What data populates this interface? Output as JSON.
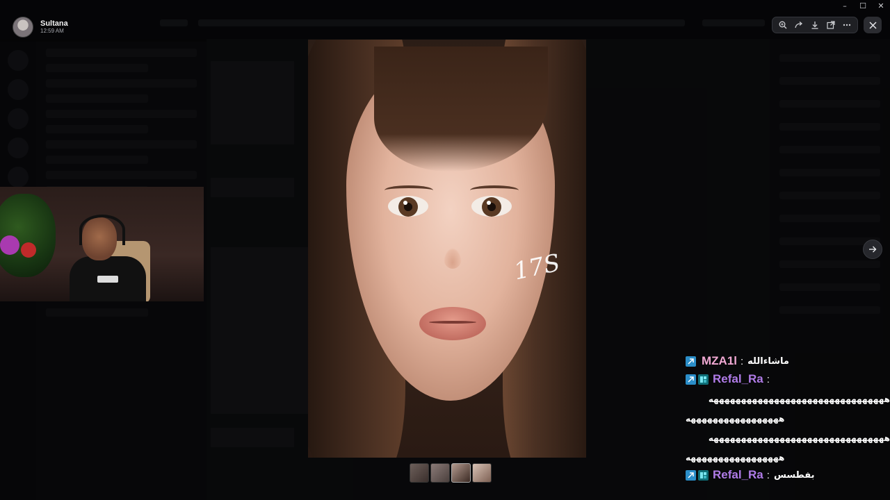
{
  "poster": {
    "name": "Sultana",
    "time": "12:59 AM"
  },
  "window_controls": {
    "minimize": "–",
    "maximize": "☐",
    "close": "✕"
  },
  "toolbar": {
    "buttons": [
      "zoom-in-icon",
      "share-icon",
      "download-icon",
      "open-external-icon",
      "more-icon"
    ]
  },
  "viewer": {
    "image_watermark": "17S",
    "thumbnail_count": 4
  },
  "chat": {
    "messages": [
      {
        "user": "MZA1l",
        "text": "ماشاءالله"
      },
      {
        "user": "Refal_Ra",
        "text": ""
      },
      {
        "text": "ههههههههههههههههههههههههههههههههه"
      },
      {
        "text": "هههههههههههههههههه"
      },
      {
        "text": "ههههههههههههههههههههههههههههههههه"
      },
      {
        "text": "هههههههههههههههههه"
      },
      {
        "user": "Refal_Ra",
        "text": "بفطسس"
      }
    ]
  },
  "colors": {
    "user_mza1l": "#f1a9d3",
    "user_refal": "#b07ce8",
    "prime_badge": "#2b8ec9"
  }
}
